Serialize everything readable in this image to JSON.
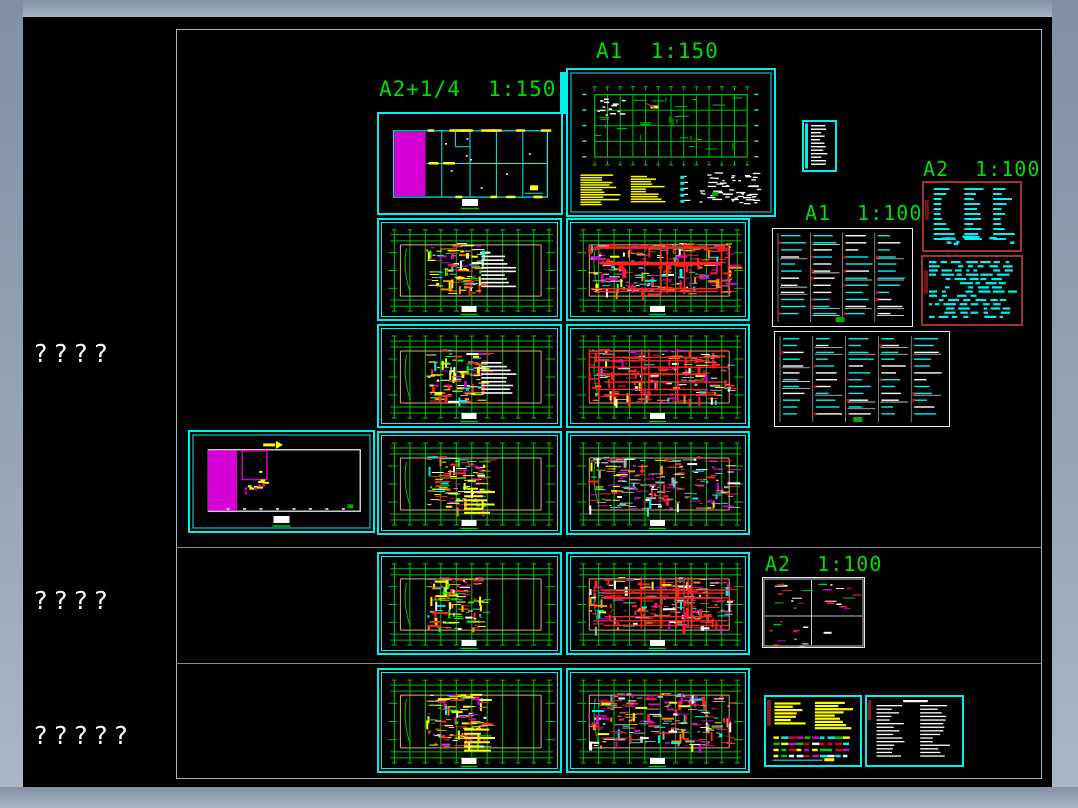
{
  "viewer": {
    "canvas_background": "#000000",
    "chrome_color_top": "#8190a6",
    "chrome_color_bottom": "#abb7c7",
    "panel_border_color": "#b4b4b4"
  },
  "sidebar": {
    "labels": [
      "????",
      "????",
      "?????"
    ]
  },
  "sheet_labels": {
    "a2_quarter_150": "A2+1/4  1:150",
    "a1_150": "A1  1:150",
    "a1_100": "A1  1:100",
    "a2_100_schedules": "A2  1:100",
    "a2_100_details": "A2  1:100"
  },
  "colors": {
    "label_green": "#00dd00",
    "grid_green": "#00c400",
    "frame_cyan": "#00efef",
    "highlight_magenta": "#d400d4",
    "annotation_yellow": "#ffff00",
    "wiring_red": "#ff2222",
    "schedule_border_red": "#a13232",
    "building_tan": "#d8b080"
  }
}
